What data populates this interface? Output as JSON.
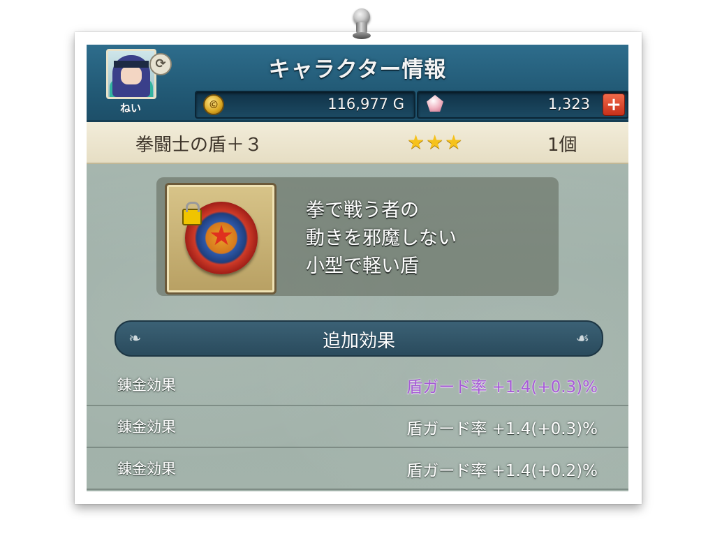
{
  "header": {
    "title": "キャラクター情報",
    "player_name": "ねい",
    "gold": "116,977 G",
    "gems": "1,323"
  },
  "item": {
    "name": "拳闘士の盾＋３",
    "stars": 3,
    "count": "1個",
    "description": [
      "拳で戦う者の",
      "動きを邪魔しない",
      "小型で軽い盾"
    ]
  },
  "effects": {
    "title": "追加効果",
    "rows": [
      {
        "label": "錬金効果",
        "value": "盾ガード率 +1.4(+0.3)%",
        "highlight": true
      },
      {
        "label": "錬金効果",
        "value": "盾ガード率 +1.4(+0.3)%",
        "highlight": false
      },
      {
        "label": "錬金効果",
        "value": "盾ガード率 +1.4(+0.2)%",
        "highlight": false
      }
    ]
  },
  "colors": {
    "header_blue": "#225a76",
    "star_gold": "#f6c21c",
    "highlight_purple": "#a65bd6",
    "add_button_red": "#c7301a"
  },
  "icons": {
    "swap": "swap-icon",
    "gold": "gold-coin-icon",
    "gem": "gem-icon",
    "add": "plus-icon",
    "lock": "lock-icon",
    "item": "shield-icon",
    "star": "star-icon"
  }
}
